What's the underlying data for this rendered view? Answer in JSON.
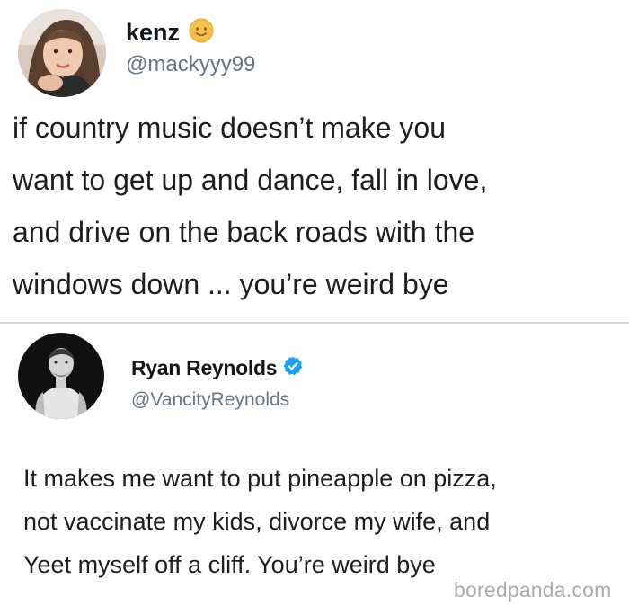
{
  "tweets": [
    {
      "display_name": "kenz",
      "handle": "@mackyyy99",
      "name_badge": "smiling-face-emoji-icon",
      "text_lines": [
        "if country music doesn’t make you",
        "want to get up and dance, fall in love,",
        "and drive on the back roads with the",
        "windows down ... you’re weird bye"
      ]
    },
    {
      "display_name": "Ryan Reynolds",
      "handle": "@VancityReynolds",
      "name_badge": "verified-badge-icon",
      "text_lines": [
        "It makes me want to put pineapple on pizza,",
        "not vaccinate my kids, divorce  my wife, and",
        "Yeet myself off a cliff. You’re weird bye"
      ]
    }
  ],
  "watermark": "boredpanda.com",
  "colors": {
    "verified_blue": "#1da1f2",
    "handle_gray": "#657786",
    "emoji_yellow": "#f7c04a"
  }
}
